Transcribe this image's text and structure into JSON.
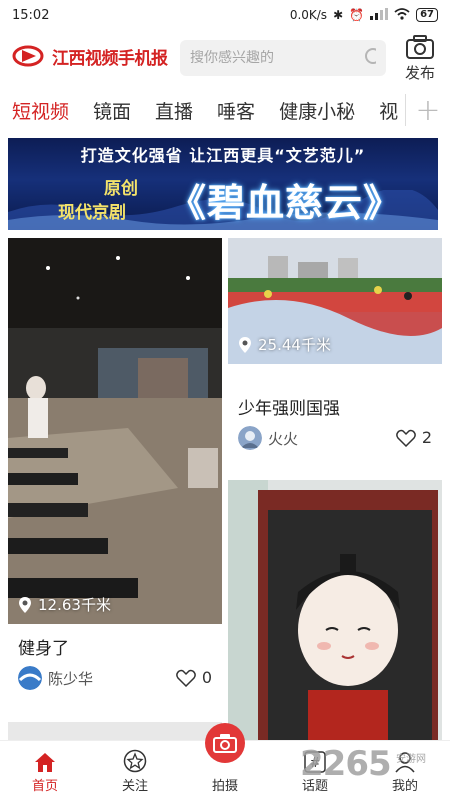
{
  "status_bar": {
    "time": "15:02",
    "speed": "0.0K/s",
    "battery": "67"
  },
  "header": {
    "logo_text": "江西视频手机报",
    "search_placeholder": "搜你感兴趣的",
    "publish_label": "发布"
  },
  "tabs": [
    "短视频",
    "镜面",
    "直播",
    "唾客",
    "健康小秘",
    "视"
  ],
  "banner": {
    "top_text": "打造文化强省 让江西更具“文艺范儿”",
    "sub1": "原创",
    "sub2": "现代京剧",
    "title": "《碧血慈云》"
  },
  "cards": [
    {
      "distance": "12.63千米",
      "title": "健身了",
      "user": "陈少华",
      "likes": "0"
    },
    {
      "distance": "25.44千米",
      "title": "少年强则国强",
      "user": "火火",
      "likes": "2"
    }
  ],
  "bottom_nav": [
    {
      "label": "首页",
      "icon": "home-icon"
    },
    {
      "label": "关注",
      "icon": "star-icon"
    },
    {
      "label": "拍摄",
      "icon": "camera-icon"
    },
    {
      "label": "话题",
      "icon": "hashtag-icon"
    },
    {
      "label": "我的",
      "icon": "user-icon"
    }
  ],
  "watermark": {
    "text": "2265",
    "sub": "安游网"
  },
  "colors": {
    "accent": "#d42323",
    "banner_bg": "#0d1d55"
  }
}
